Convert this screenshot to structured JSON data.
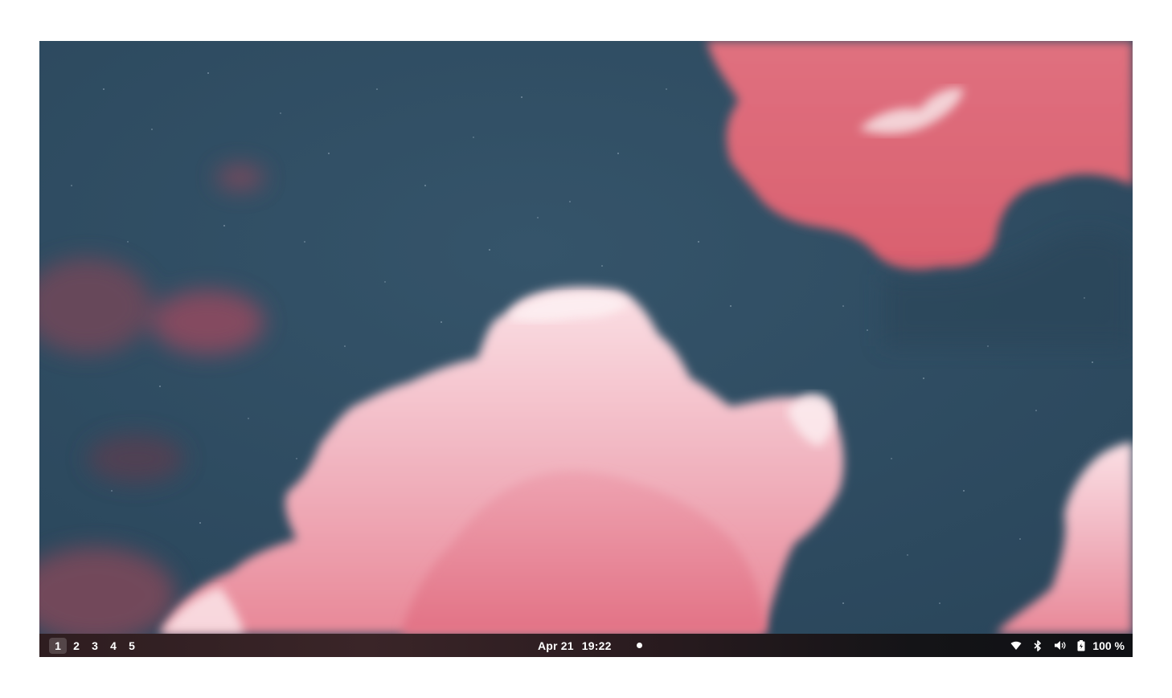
{
  "desktop": {
    "wallpaper": {
      "sky_color": "#2f4c62",
      "cloud_pink": "#de6a7c",
      "cloud_light": "#f6c9d2"
    }
  },
  "taskbar": {
    "workspaces": [
      "1",
      "2",
      "3",
      "4",
      "5"
    ],
    "active_workspace": "1",
    "date": "Apr 21",
    "time": "19:22",
    "tray": {
      "icons": [
        "wifi-icon",
        "bluetooth-icon",
        "volume-icon",
        "battery-icon"
      ],
      "battery_label": "100 %"
    }
  }
}
